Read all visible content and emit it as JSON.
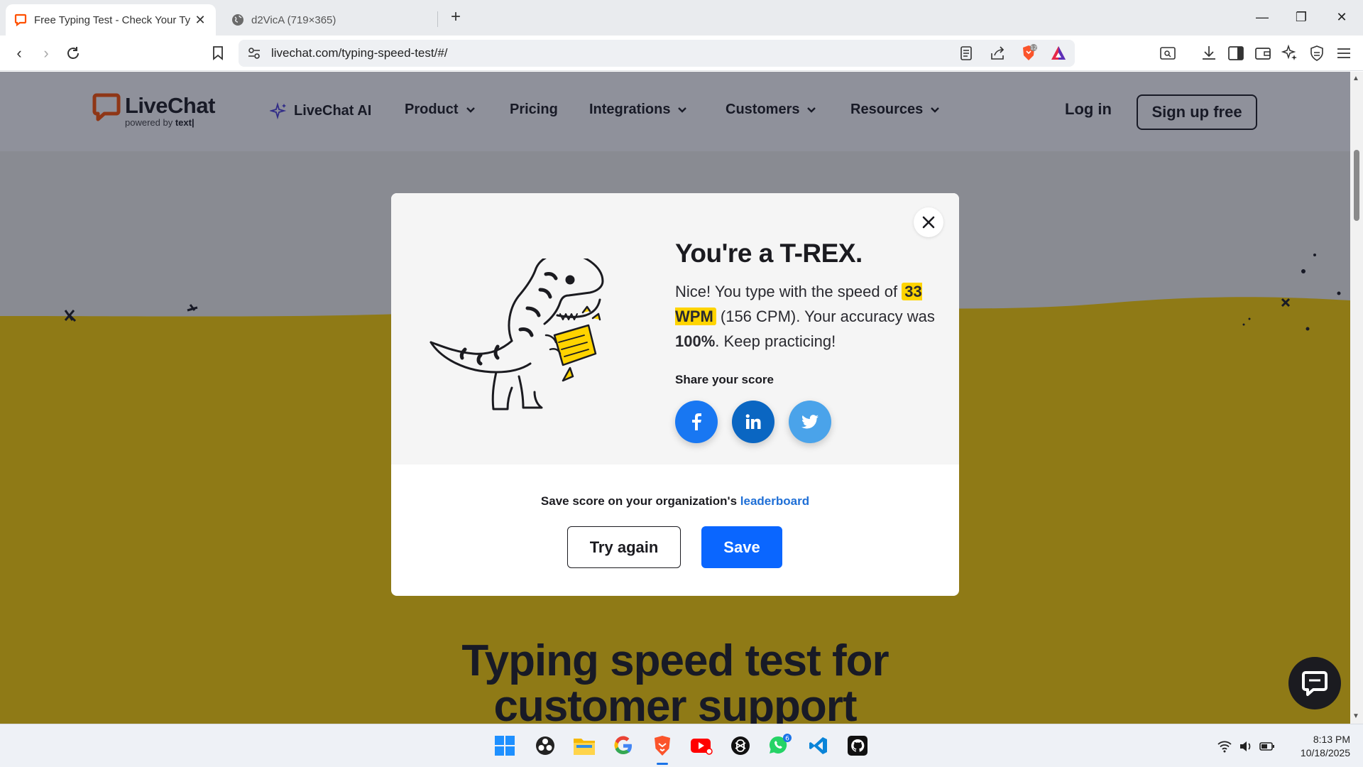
{
  "browser": {
    "tabs": [
      {
        "title": "Free Typing Test - Check Your Ty",
        "active": true
      },
      {
        "title": "d2VicA (719×365)",
        "active": false
      }
    ],
    "url": "livechat.com/typing-speed-test/#/",
    "shield_badge": "12"
  },
  "site": {
    "logo_text": "LiveChat",
    "logo_sub_prefix": "powered by ",
    "logo_sub_brand": "text|",
    "nav": {
      "ai": "LiveChat AI",
      "product": "Product",
      "pricing": "Pricing",
      "integrations": "Integrations",
      "customers": "Customers",
      "resources": "Resources"
    },
    "login": "Log in",
    "signup": "Sign up free",
    "hero_line1": "Typing speed test for",
    "hero_line2": "customer support",
    "hero_color": "#ffd400"
  },
  "modal": {
    "title": "You're a T-REX.",
    "text_before": "Nice! You type with the speed of ",
    "wpm": "33 WPM",
    "text_mid": " (156 CPM). Your accuracy was ",
    "accuracy": "100%",
    "text_after": ". Keep practicing!",
    "share_label": "Share your score",
    "share_buttons": [
      "facebook-icon",
      "linkedin-icon",
      "twitter-icon"
    ],
    "save_prefix": "Save score on your organization's ",
    "save_link": "leaderboard",
    "try_again": "Try again",
    "save": "Save"
  },
  "taskbar": {
    "apps": [
      "windows-start-icon",
      "obs-icon",
      "file-explorer-icon",
      "google-chrome-icon",
      "brave-browser-icon",
      "youtube-icon",
      "chatgpt-icon",
      "whatsapp-icon",
      "vscode-icon",
      "github-icon"
    ],
    "whatsapp_badge": "6",
    "time": "8:13 PM",
    "date": "10/18/2025"
  }
}
